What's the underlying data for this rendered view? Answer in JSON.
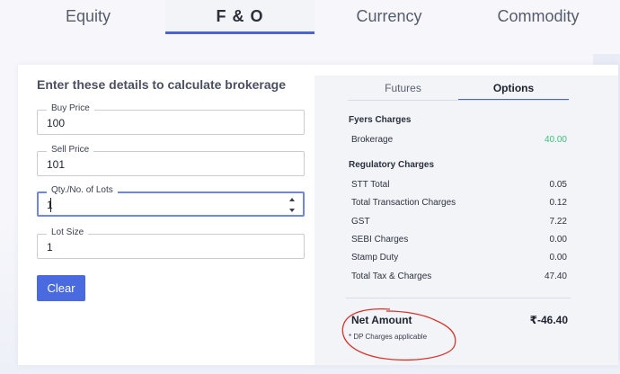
{
  "top_tabs": [
    {
      "label": "Equity",
      "active": false
    },
    {
      "label": "F & O",
      "active": true
    },
    {
      "label": "Currency",
      "active": false
    },
    {
      "label": "Commodity",
      "active": false
    }
  ],
  "form": {
    "title": "Enter these details to calculate brokerage",
    "fields": [
      {
        "label": "Buy Price",
        "value": "100"
      },
      {
        "label": "Sell Price",
        "value": "101"
      },
      {
        "label": "Qty./No. of Lots",
        "value": "1"
      },
      {
        "label": "Lot Size",
        "value": "1"
      }
    ],
    "clear_label": "Clear"
  },
  "results": {
    "tabs": [
      {
        "label": "Futures",
        "active": false
      },
      {
        "label": "Options",
        "active": true
      }
    ],
    "fyers_title": "Fyers Charges",
    "fyers_rows": [
      {
        "label": "Brokerage",
        "value": "40.00"
      }
    ],
    "regulatory_title": "Regulatory Charges",
    "regulatory_rows": [
      {
        "label": "STT Total",
        "value": "0.05"
      },
      {
        "label": "Total Transaction Charges",
        "value": "0.12"
      },
      {
        "label": "GST",
        "value": "7.22"
      },
      {
        "label": "SEBI Charges",
        "value": "0.00"
      },
      {
        "label": "Stamp Duty",
        "value": "0.00"
      },
      {
        "label": "Total Tax & Charges",
        "value": "47.40"
      }
    ],
    "net_label": "Net Amount",
    "net_value": "₹-46.40",
    "dp_note": "* DP Charges applicable"
  },
  "colors": {
    "accent": "#4a63d6",
    "button": "#4a6ae0",
    "positive": "#3ac17a",
    "annotation": "#d9342b"
  }
}
